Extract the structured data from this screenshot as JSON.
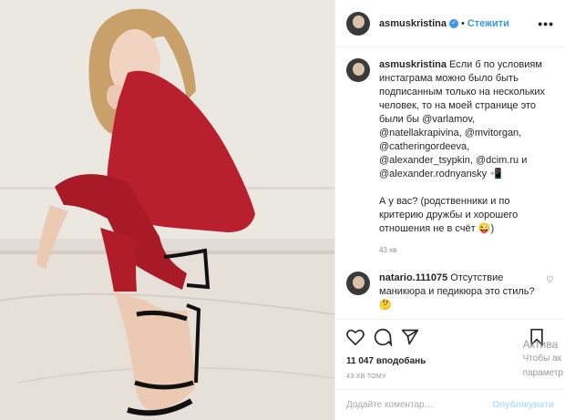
{
  "post": {
    "username": "asmuskristina",
    "follow_label": "Стежити",
    "verified_mark": "✓",
    "more_glyph": "•••",
    "caption_user": "asmuskristina",
    "caption_text": "Если б по условиям инстаграма можно было быть подписанным только на нескольких человек, то на моей странице это были бы @varlamov, @natellakrapivina, @mvitorgan, @catheringordeeva, @alexander_tsypkin, @dcim.ru и @alexander.rodnyansky 📲\n\nА у вас? (родственники и по критерию дружбы и хорошего отношения не в счёт 😜)",
    "caption_time": "43 хв",
    "comment_user": "natario.111075",
    "comment_text": "Отсутствие маникюра и педикюра это стиль?🤔",
    "likes": "11 047 вподобань",
    "ago": "43 ХВ ТОМУ",
    "add_comment_placeholder": "Додайте коментар…",
    "publish_label": "Опублікувати",
    "accent_color": "#3897f0"
  },
  "watermark": {
    "line1": "Актива",
    "line2": "Чтобы ак",
    "line3": "параметр"
  }
}
